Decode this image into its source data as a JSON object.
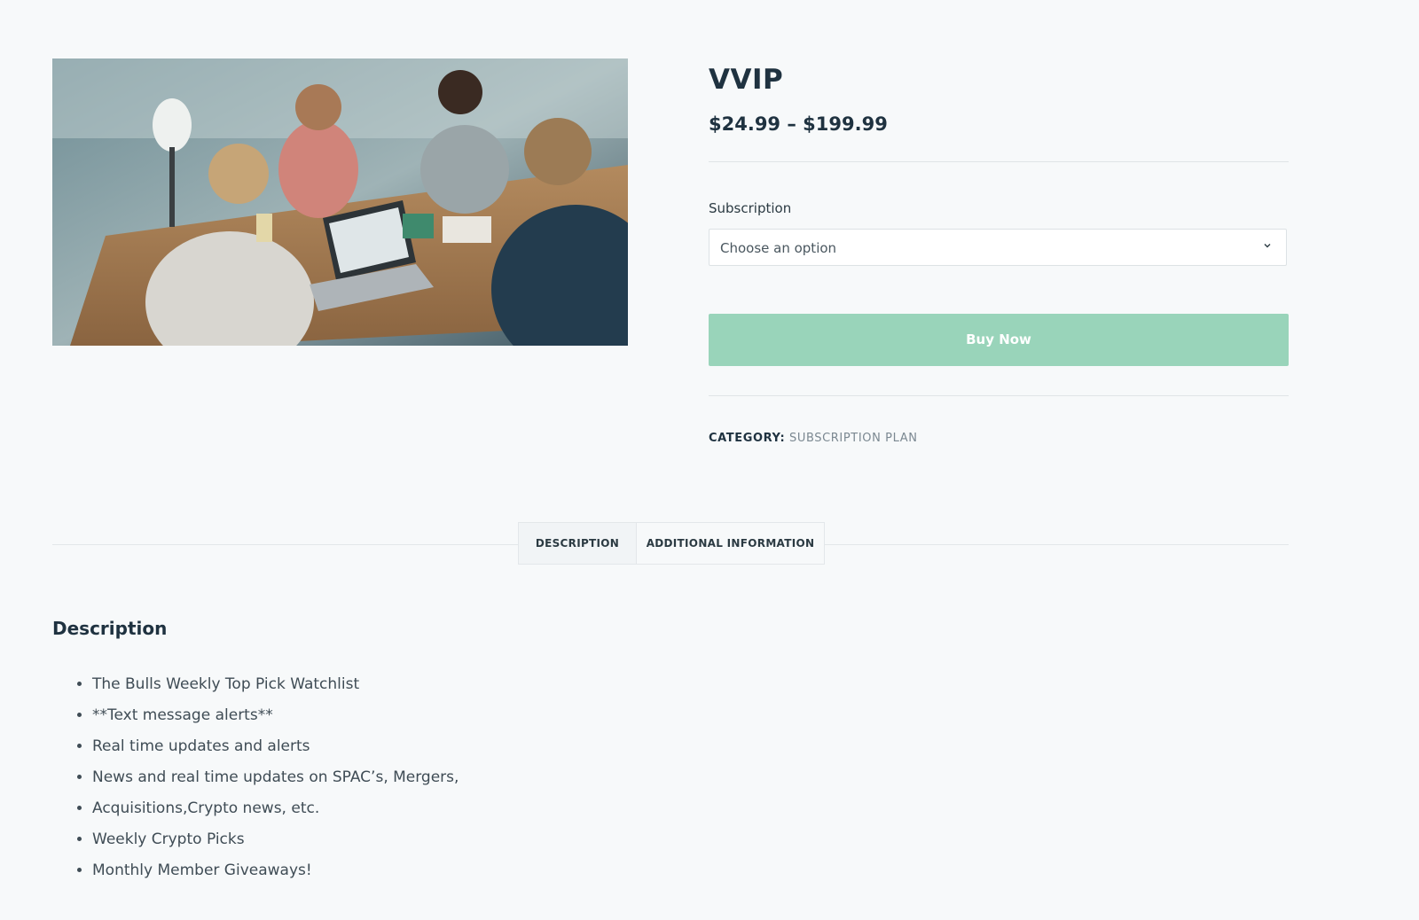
{
  "product": {
    "title": "VVIP",
    "price": "$24.99 – $199.99",
    "image_alt": "people working at a table with laptop"
  },
  "variation": {
    "label": "Subscription",
    "selected": "Choose an option"
  },
  "actions": {
    "buy_label": "Buy Now"
  },
  "meta": {
    "category_label": "CATEGORY:",
    "category_value": "SUBSCRIPTION PLAN"
  },
  "tabs": [
    {
      "label": "DESCRIPTION",
      "active": true
    },
    {
      "label": "ADDITIONAL INFORMATION",
      "active": false
    }
  ],
  "description": {
    "heading": "Description",
    "items": [
      "The Bulls Weekly Top Pick Watchlist",
      "**Text message alerts**",
      "Real time updates and alerts",
      "News and real time updates on SPAC’s, Mergers,",
      "Acquisitions,Crypto news, etc.",
      "Weekly Crypto Picks",
      "Monthly Member Giveaways!"
    ]
  },
  "colors": {
    "background": "#f7f9fa",
    "button": "#99d4ba",
    "text_dark": "#1f3240",
    "muted": "#7b8891"
  }
}
